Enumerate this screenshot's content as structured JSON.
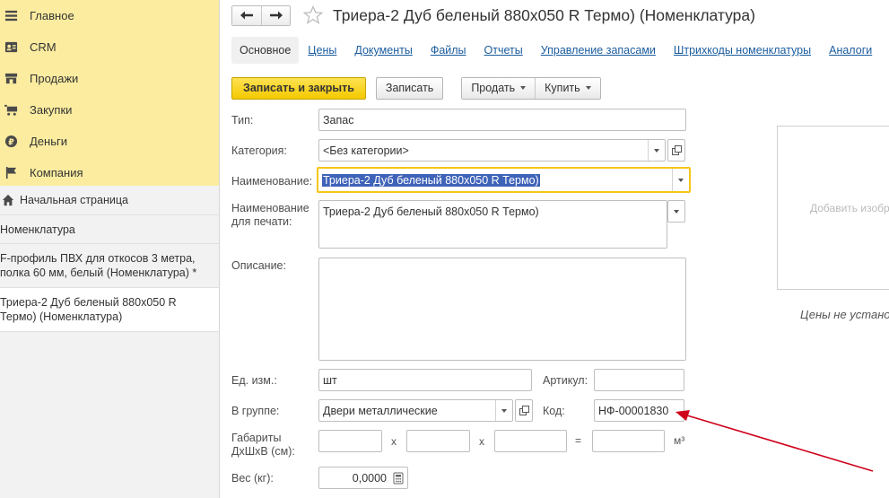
{
  "sidebar": {
    "nav": [
      {
        "label": "Главное",
        "icon": "menu-icon"
      },
      {
        "label": "CRM",
        "icon": "contact-card-icon"
      },
      {
        "label": "Продажи",
        "icon": "shop-icon"
      },
      {
        "label": "Закупки",
        "icon": "cart-icon"
      },
      {
        "label": "Деньги",
        "icon": "ruble-icon"
      },
      {
        "label": "Компания",
        "icon": "flag-icon"
      }
    ],
    "open_windows": [
      {
        "label": "Начальная страница"
      },
      {
        "label": "Номенклатура"
      },
      {
        "label": "F-профиль ПВХ для откосов 3 метра, полка 60 мм, белый (Номенклатура) *"
      },
      {
        "label": "Триера-2 Дуб беленый 880x050 R Термо) (Номенклатура)"
      }
    ]
  },
  "header": {
    "title": "Триера-2 Дуб беленый 880x050 R Термо) (Номенклатура)"
  },
  "tabs": [
    "Основное",
    "Цены",
    "Документы",
    "Файлы",
    "Отчеты",
    "Управление запасами",
    "Штрихкоды номенклатуры",
    "Аналоги"
  ],
  "toolbar": {
    "save_close": "Записать и закрыть",
    "save": "Записать",
    "sell": "Продать",
    "buy": "Купить"
  },
  "form": {
    "type_label": "Тип:",
    "type_value": "Запас",
    "category_label": "Категория:",
    "category_value": "<Без категории>",
    "name_label": "Наименование:",
    "name_value": "Триера-2 Дуб беленый 880x050 R Термо)",
    "print_name_label_1": "Наименование",
    "print_name_label_2": "для печати:",
    "print_name_value": "Триера-2 Дуб беленый 880x050 R Термо)",
    "description_label": "Описание:",
    "description_value": "",
    "unit_label": "Ед. изм.:",
    "unit_value": "шт",
    "article_label": "Артикул:",
    "article_value": "",
    "group_label": "В группе:",
    "group_value": "Двери металлические",
    "code_label": "Код:",
    "code_value": "НФ-00001830",
    "dims_label_1": "Габариты",
    "dims_label_2": "ДхШхВ (см):",
    "dims_x": "x",
    "dims_eq": "=",
    "dims_unit": "м³",
    "weight_label": "Вес (кг):",
    "weight_value": "0,0000"
  },
  "right_panel": {
    "add_image": "Добавить изображение",
    "prices_note": "Цены не установлены"
  },
  "colors": {
    "nav_bg": "#fbeca0",
    "primary_button": "#f3c900",
    "link": "#1b5c9e",
    "focus_border": "#f5c518",
    "selection": "#3f63b8",
    "annotation_arrow": "#d0021b"
  }
}
